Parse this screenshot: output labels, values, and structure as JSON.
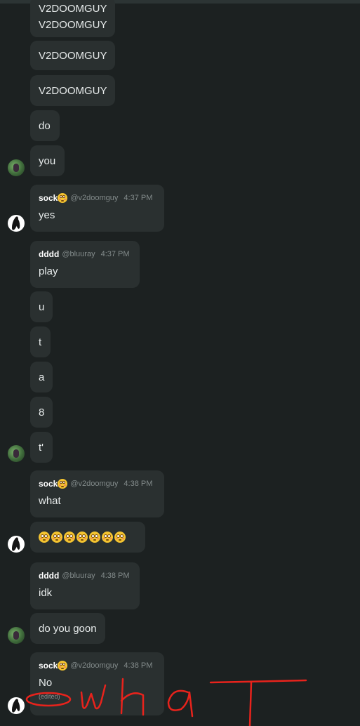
{
  "messages": {
    "m1a": "V2DOOMGUY",
    "m1b": "V2DOOMGUY",
    "m2": "V2DOOMGUY",
    "m3": "V2DOOMGUY",
    "m4": "do",
    "m5": "you",
    "sock1": {
      "author": "sock",
      "handle": "@v2doomguy",
      "time": "4:37 PM",
      "text": "yes"
    },
    "dddd1": {
      "author": "dddd",
      "handle": "@bluuray",
      "time": "4:37 PM",
      "text": "play"
    },
    "m6": "u",
    "m7": "t",
    "m8": "a",
    "m9": "8",
    "m10": "t'",
    "sock2": {
      "author": "sock",
      "handle": "@v2doomguy",
      "time": "4:38 PM",
      "text": "what"
    },
    "emoji_count": 7,
    "dddd2": {
      "author": "dddd",
      "handle": "@bluuray",
      "time": "4:38 PM",
      "text": "idk"
    },
    "m11": "do you goon",
    "sock3": {
      "author": "sock",
      "handle": "@v2doomguy",
      "time": "4:38 PM",
      "text": "No",
      "edited": "(edited)"
    }
  },
  "annotation": {
    "color": "#e8231c"
  }
}
